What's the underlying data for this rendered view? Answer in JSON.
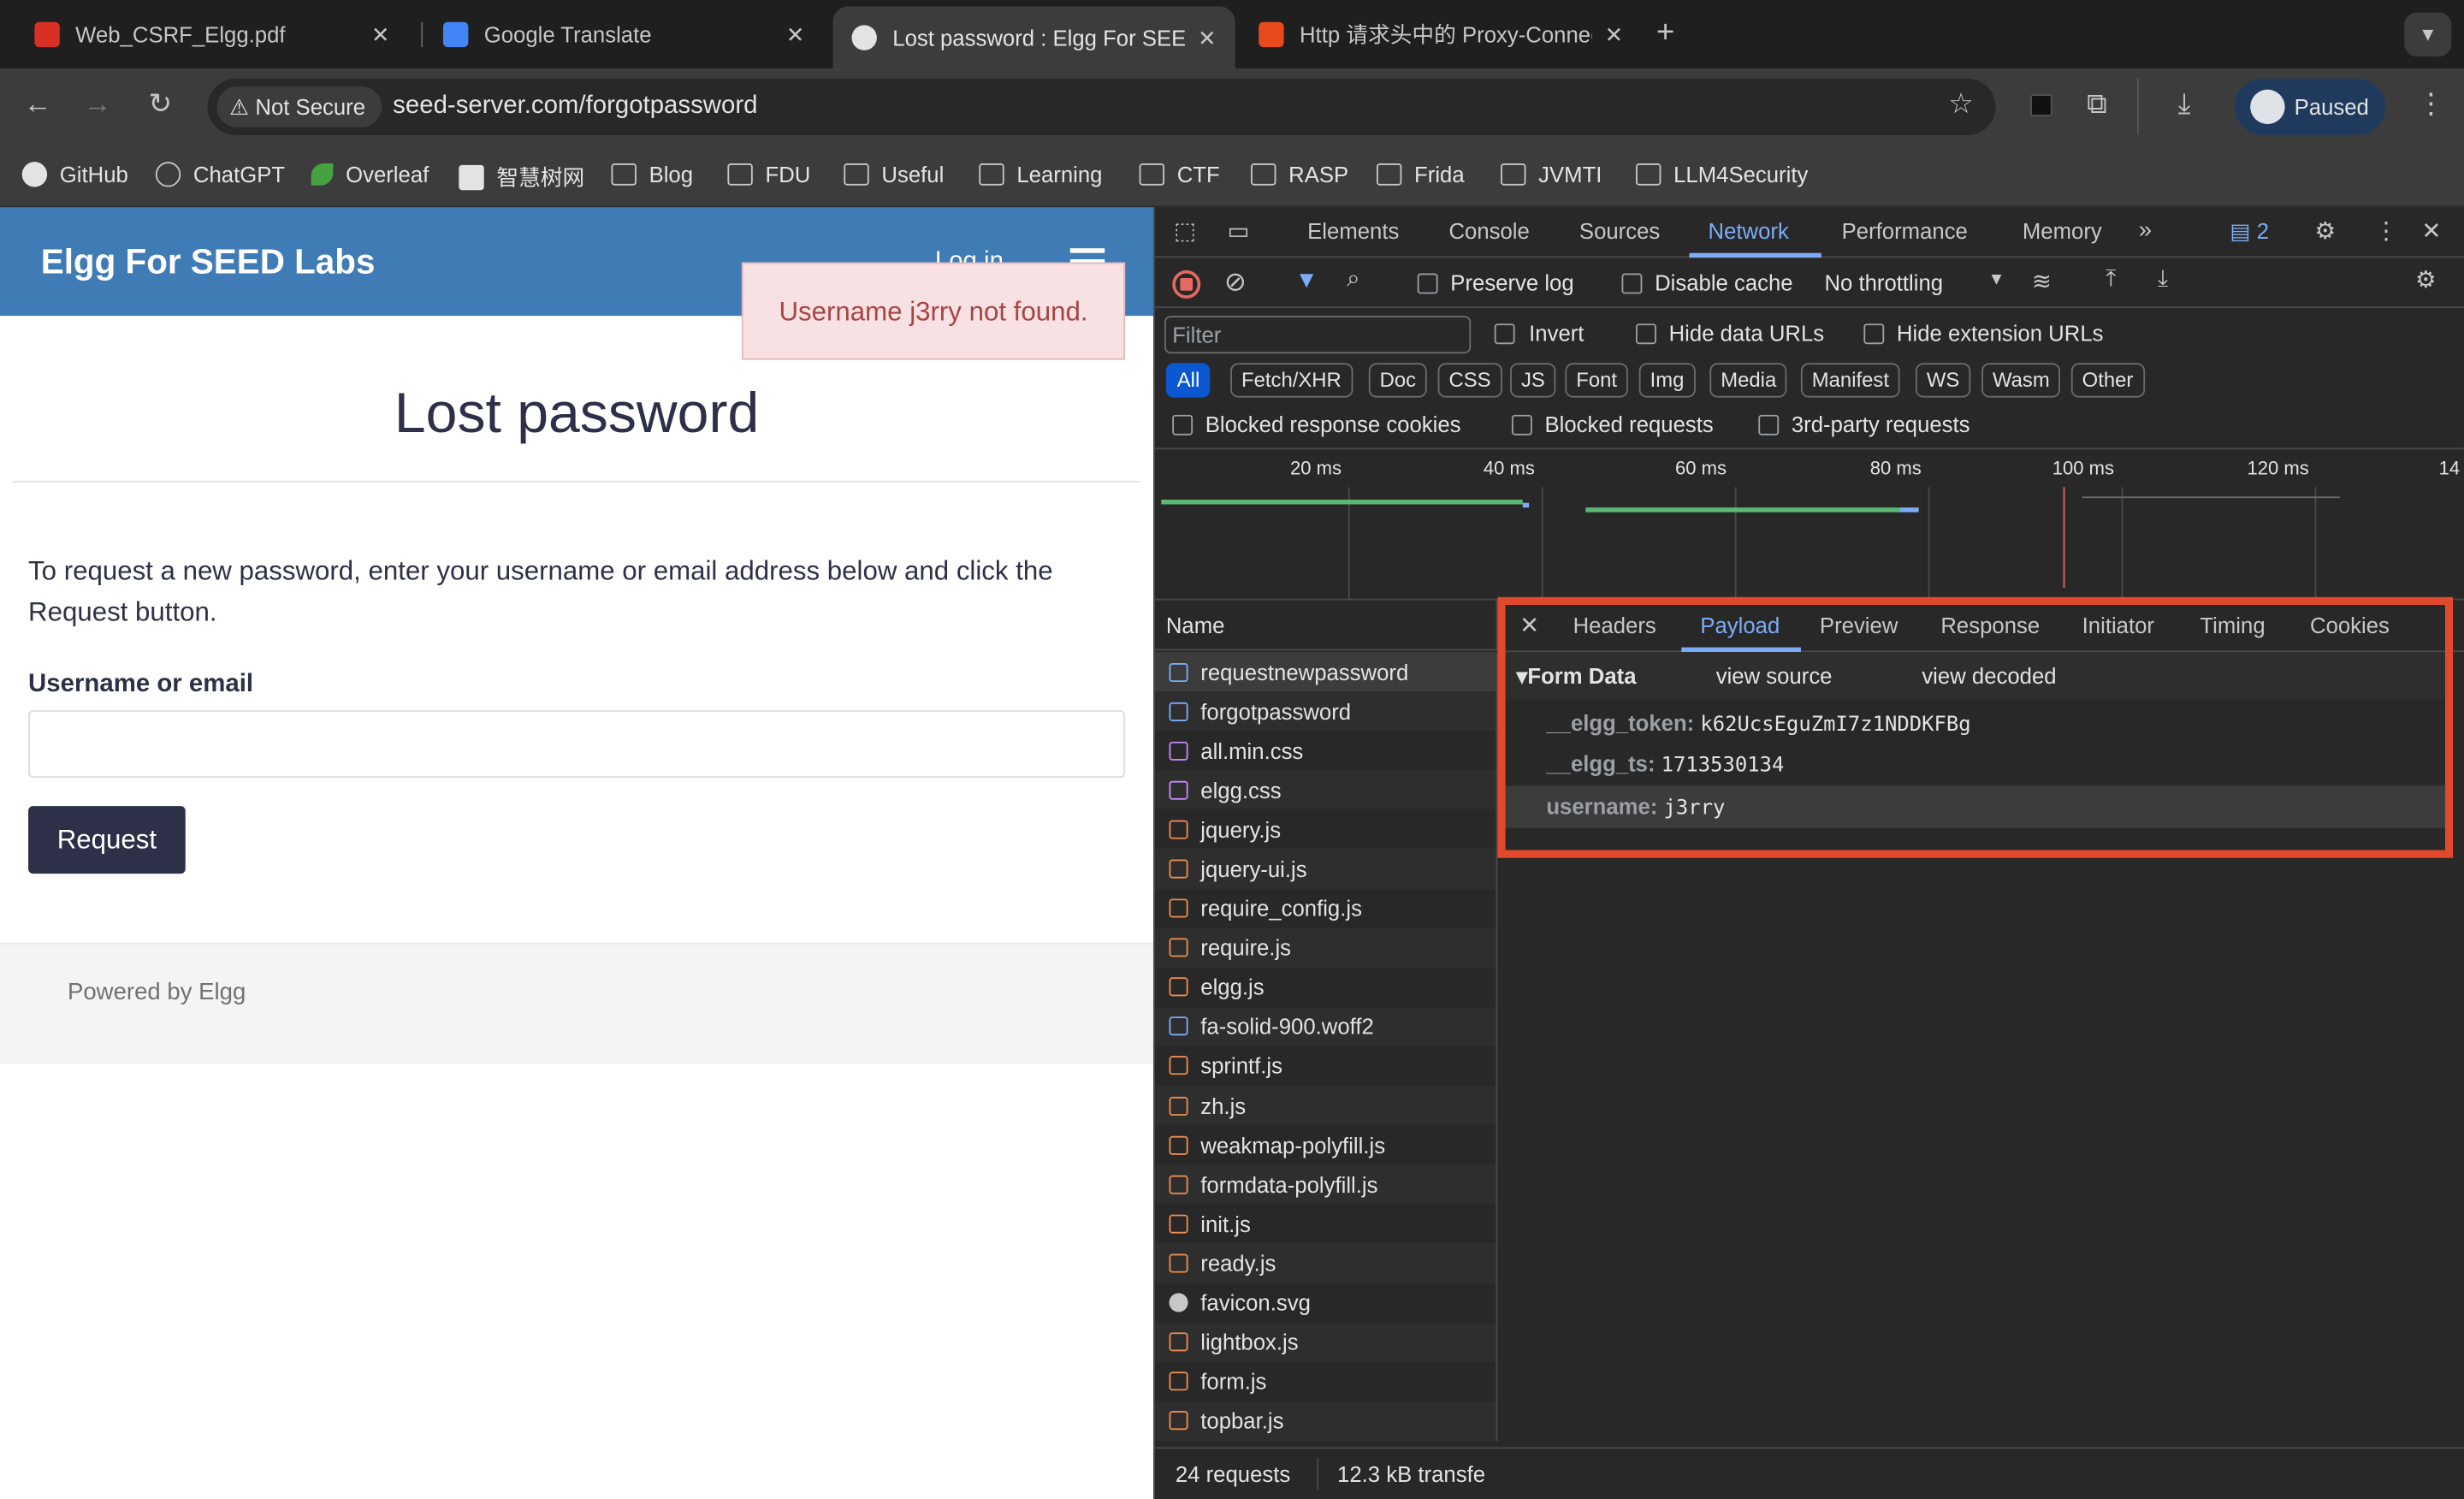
{
  "browser": {
    "tabs": [
      {
        "title": "Web_CSRF_Elgg.pdf",
        "favicon_color": "#d93025",
        "active": false
      },
      {
        "title": "Google Translate",
        "favicon_color": "#4285f4",
        "active": false
      },
      {
        "title": "Lost password : Elgg For SEED Labs",
        "favicon_color": "#e3e3e3",
        "active": true
      },
      {
        "title": "Http 请求头中的 Proxy-Connection",
        "favicon_color": "#e8491d",
        "active": false
      }
    ],
    "security_label": "Not Secure",
    "url": "seed-server.com/forgotpassword",
    "profile_label": "Paused",
    "bookmarks": [
      "GitHub",
      "ChatGPT",
      "Overleaf",
      "智慧树网",
      "Blog",
      "FDU",
      "Useful",
      "Learning",
      "CTF",
      "RASP",
      "Frida",
      "JVMTI",
      "LLM4Security"
    ]
  },
  "page": {
    "site_title": "Elgg For SEED Labs",
    "login_label": "Log in",
    "flash_message": "Username j3rry not found.",
    "title": "Lost password",
    "instructions": "To request a new password, enter your username or email address below and click the Request button.",
    "field_label": "Username or email",
    "field_value": "",
    "submit_label": "Request",
    "footer": "Powered by Elgg"
  },
  "devtools": {
    "panels": [
      "Elements",
      "Console",
      "Sources",
      "Network",
      "Performance",
      "Memory"
    ],
    "active_panel": "Network",
    "issues_count": "2",
    "toolbar": {
      "preserve_log": "Preserve log",
      "disable_cache": "Disable cache",
      "throttling": "No throttling"
    },
    "filter": {
      "placeholder": "Filter",
      "invert": "Invert",
      "hide_data_urls": "Hide data URLs",
      "hide_extension_urls": "Hide extension URLs",
      "types": [
        "All",
        "Fetch/XHR",
        "Doc",
        "CSS",
        "JS",
        "Font",
        "Img",
        "Media",
        "Manifest",
        "WS",
        "Wasm",
        "Other"
      ],
      "blocked_cookies": "Blocked response cookies",
      "blocked_requests": "Blocked requests",
      "third_party": "3rd-party requests"
    },
    "timeline_ticks": [
      "20 ms",
      "40 ms",
      "60 ms",
      "80 ms",
      "100 ms",
      "120 ms",
      "14"
    ],
    "name_column": "Name",
    "requests": [
      {
        "name": "requestnewpassword",
        "type": "doc"
      },
      {
        "name": "forgotpassword",
        "type": "doc"
      },
      {
        "name": "all.min.css",
        "type": "css"
      },
      {
        "name": "elgg.css",
        "type": "css"
      },
      {
        "name": "jquery.js",
        "type": "js"
      },
      {
        "name": "jquery-ui.js",
        "type": "js"
      },
      {
        "name": "require_config.js",
        "type": "js"
      },
      {
        "name": "require.js",
        "type": "js"
      },
      {
        "name": "elgg.js",
        "type": "js"
      },
      {
        "name": "fa-solid-900.woff2",
        "type": "font"
      },
      {
        "name": "sprintf.js",
        "type": "js"
      },
      {
        "name": "zh.js",
        "type": "js"
      },
      {
        "name": "weakmap-polyfill.js",
        "type": "js"
      },
      {
        "name": "formdata-polyfill.js",
        "type": "js"
      },
      {
        "name": "init.js",
        "type": "js"
      },
      {
        "name": "ready.js",
        "type": "js"
      },
      {
        "name": "favicon.svg",
        "type": "img"
      },
      {
        "name": "lightbox.js",
        "type": "js"
      },
      {
        "name": "form.js",
        "type": "js"
      },
      {
        "name": "topbar.js",
        "type": "js"
      }
    ],
    "status": {
      "requests": "24 requests",
      "transferred": "12.3 kB transfe"
    },
    "detail_tabs": [
      "Headers",
      "Payload",
      "Preview",
      "Response",
      "Initiator",
      "Timing",
      "Cookies"
    ],
    "active_detail_tab": "Payload",
    "form_data": {
      "title": "Form Data",
      "view_source": "view source",
      "view_decoded": "view decoded",
      "fields": [
        {
          "key": "__elgg_token:",
          "value": "k62UcsEguZmI7z1NDDKFBg"
        },
        {
          "key": "__elgg_ts:",
          "value": "1713530134"
        },
        {
          "key": "username:",
          "value": "j3rry"
        }
      ]
    }
  }
}
